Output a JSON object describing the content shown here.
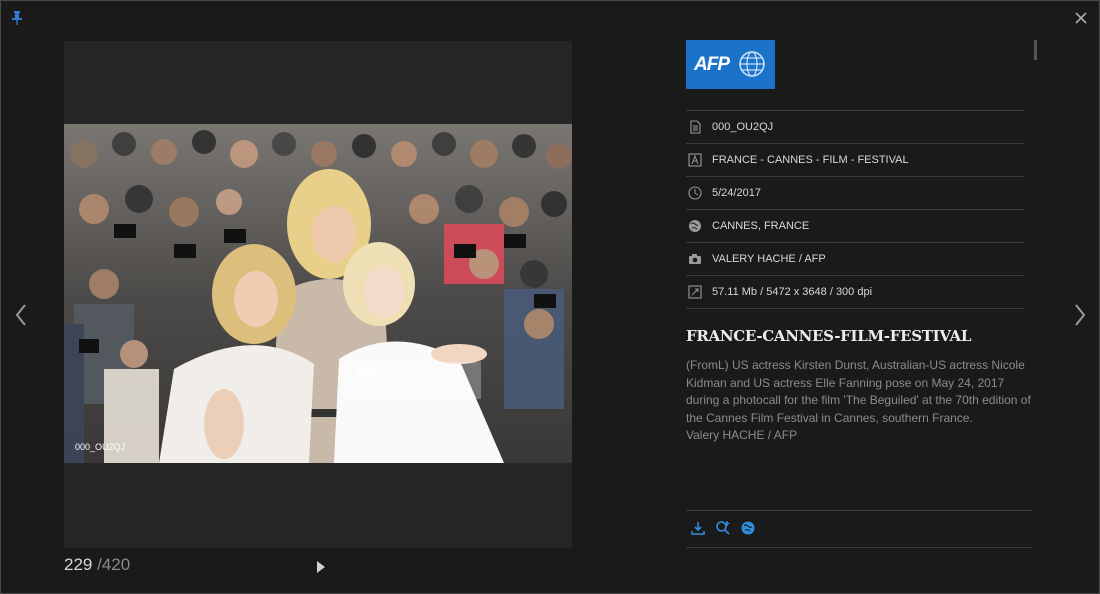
{
  "header": {
    "pin_icon": "pin-icon",
    "close_icon": "close-icon"
  },
  "navigation": {
    "prev_icon": "chevron-left-icon",
    "next_icon": "chevron-right-icon"
  },
  "photo": {
    "watermark_logo": "AFP",
    "watermark_credit": "Valery HACHE / AFP",
    "photo_id_label": "000_OU2QJ"
  },
  "counter": {
    "current": "229",
    "total": "/420"
  },
  "player": {
    "play_icon": "play-icon"
  },
  "agency_logo": {
    "text": "AFP",
    "color": "#1a73c8"
  },
  "metadata": [
    {
      "icon": "document-icon",
      "value": "000_OU2QJ"
    },
    {
      "icon": "text-icon",
      "value": "FRANCE - CANNES - FILM - FESTIVAL"
    },
    {
      "icon": "clock-icon",
      "value": "5/24/2017"
    },
    {
      "icon": "globe-icon",
      "value": "CANNES, FRANCE"
    },
    {
      "icon": "camera-icon",
      "value": "VALERY HACHE / AFP"
    },
    {
      "icon": "resize-icon",
      "value": "57.11 Mb / 5472 x 3648 / 300 dpi"
    }
  ],
  "headline": "FRANCE-CANNES-FILM-FESTIVAL",
  "caption": {
    "body": "(FromL) US actress Kirsten Dunst, Australian-US actress Nicole Kidman and US actress Elle Fanning pose on May 24, 2017 during a photocall for the film 'The Beguiled' at the 70th edition of the Cannes Film Festival in Cannes, southern France.",
    "credit": "Valery HACHE / AFP"
  },
  "actions": [
    {
      "icon": "download-icon"
    },
    {
      "icon": "zoom-in-icon"
    },
    {
      "icon": "globe-icon"
    }
  ],
  "colors": {
    "accent": "#1a73c8",
    "background": "#1a1a1a",
    "caption_text": "#8c8c8c"
  }
}
